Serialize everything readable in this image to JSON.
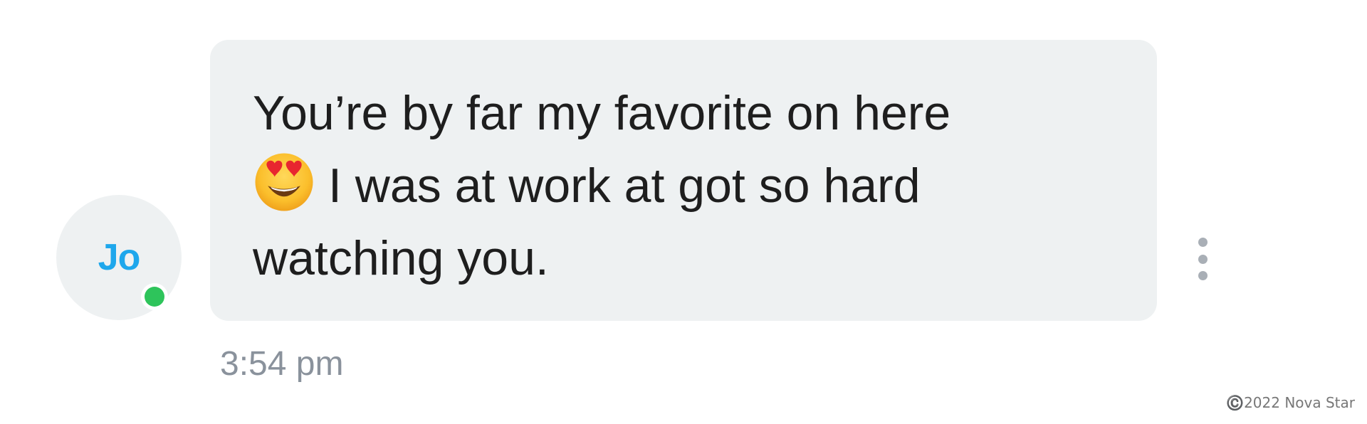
{
  "contact": {
    "initials": "Jo",
    "initials_color": "#1ea7ec",
    "online_status_color": "#2ec45b",
    "avatar_background": "#eef1f2"
  },
  "message": {
    "line1": "You’re by far my favorite on here",
    "emoji": "heart-eyes-emoji-icon",
    "line2": "I was at work at got so hard",
    "line3": "watching you.",
    "bubble_color": "#eef1f2",
    "text_color": "#1e1e1e",
    "timestamp": "3:54 pm"
  },
  "actions": {
    "more_icon": "vertical-ellipsis-icon"
  },
  "footer": {
    "copyright": "©️2022 Nova Star"
  }
}
